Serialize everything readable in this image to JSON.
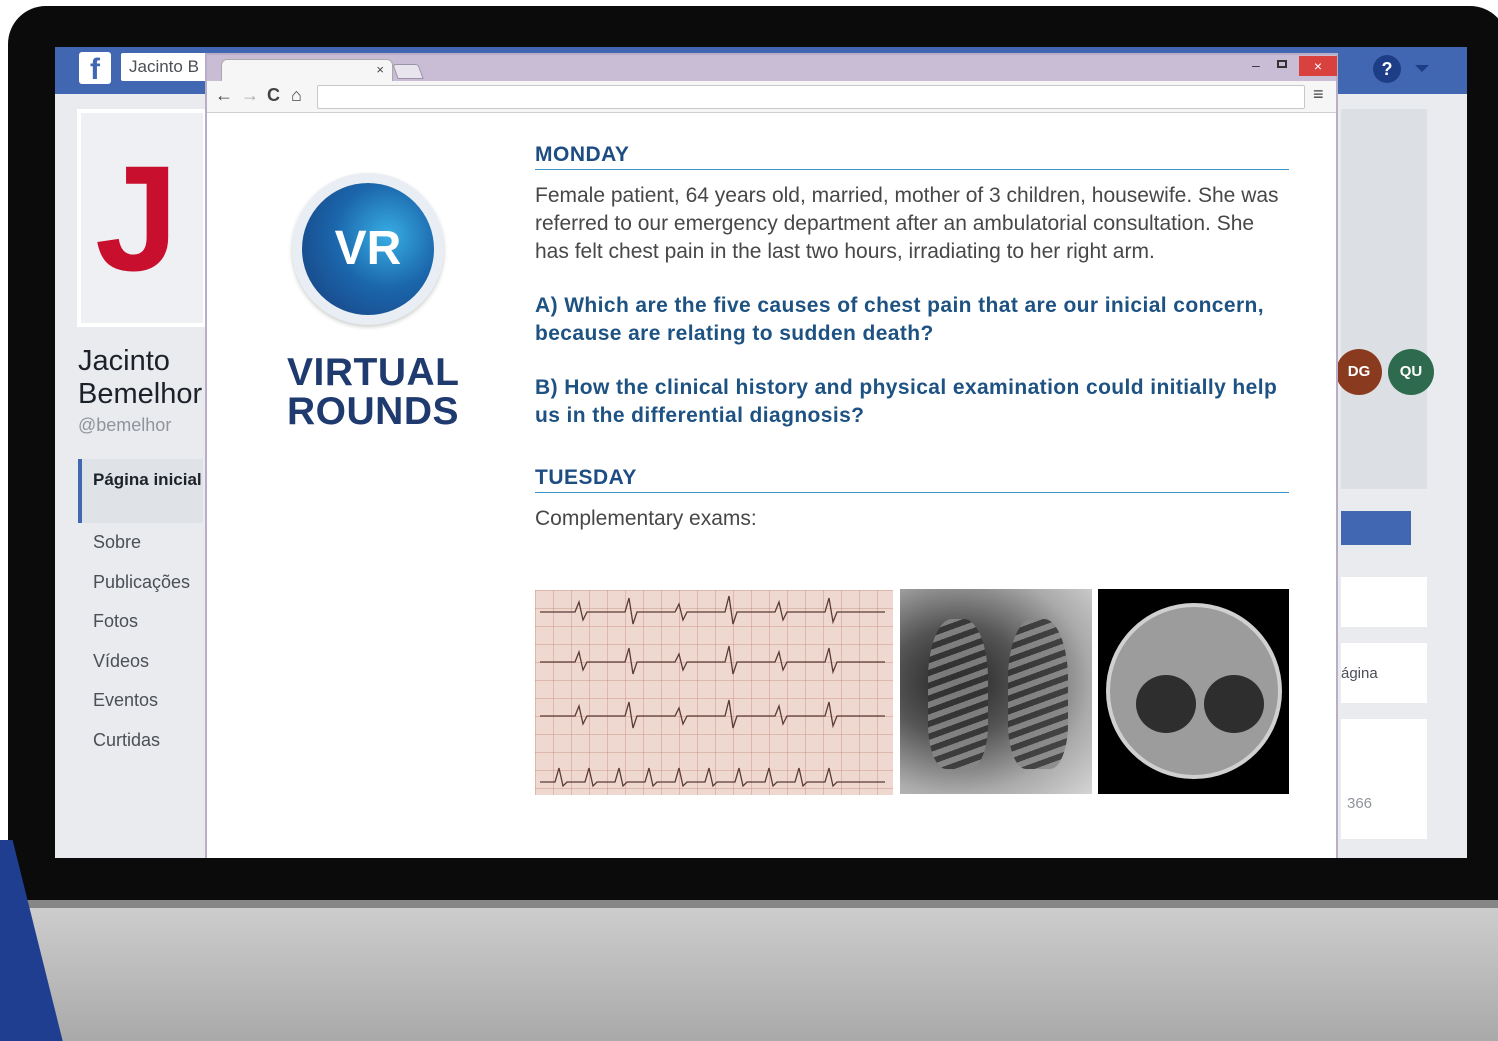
{
  "facebook": {
    "logo": "f",
    "search_value": "Jacinto B",
    "cover_letter": "J",
    "page_name": "Jacinto Bemelhor",
    "handle": "@bemelhor",
    "nav": [
      "Página inicial",
      "Sobre",
      "Publicações",
      "Fotos",
      "Vídeos",
      "Eventos",
      "Curtidas"
    ],
    "help": "?",
    "badges": [
      "DG",
      "QU"
    ],
    "right_text_1": "ágina",
    "right_text_2": "366"
  },
  "browser": {
    "tab_close": "×",
    "window_min": "–",
    "window_close": "×",
    "back": "←",
    "forward": "→",
    "reload": "C",
    "home": "⌂",
    "menu": "≡",
    "address": ""
  },
  "content": {
    "logo_text": "VR",
    "title_line1": "VIRTUAL",
    "title_line2": "ROUNDS",
    "monday_heading": "MONDAY",
    "case_text": "Female patient, 64 years old, married, mother of 3 children, housewife. She was referred to our emergency department after an ambulatorial consultation. She has felt chest pain in the last two hours, irradiating to her right arm.",
    "question_a": "A)  Which are the five causes of chest pain that are our inicial concern, because are relating to sudden death?",
    "question_b": "B) How the clinical history and physical examination could initially help us in the differential diagnosis?",
    "tuesday_heading": "TUESDAY",
    "exams_label": "Complementary exams:"
  },
  "colors": {
    "facebook_blue": "#4267b2",
    "heading_blue": "#1d4d83",
    "title_navy": "#1f3a6e",
    "close_red": "#d9413e"
  }
}
